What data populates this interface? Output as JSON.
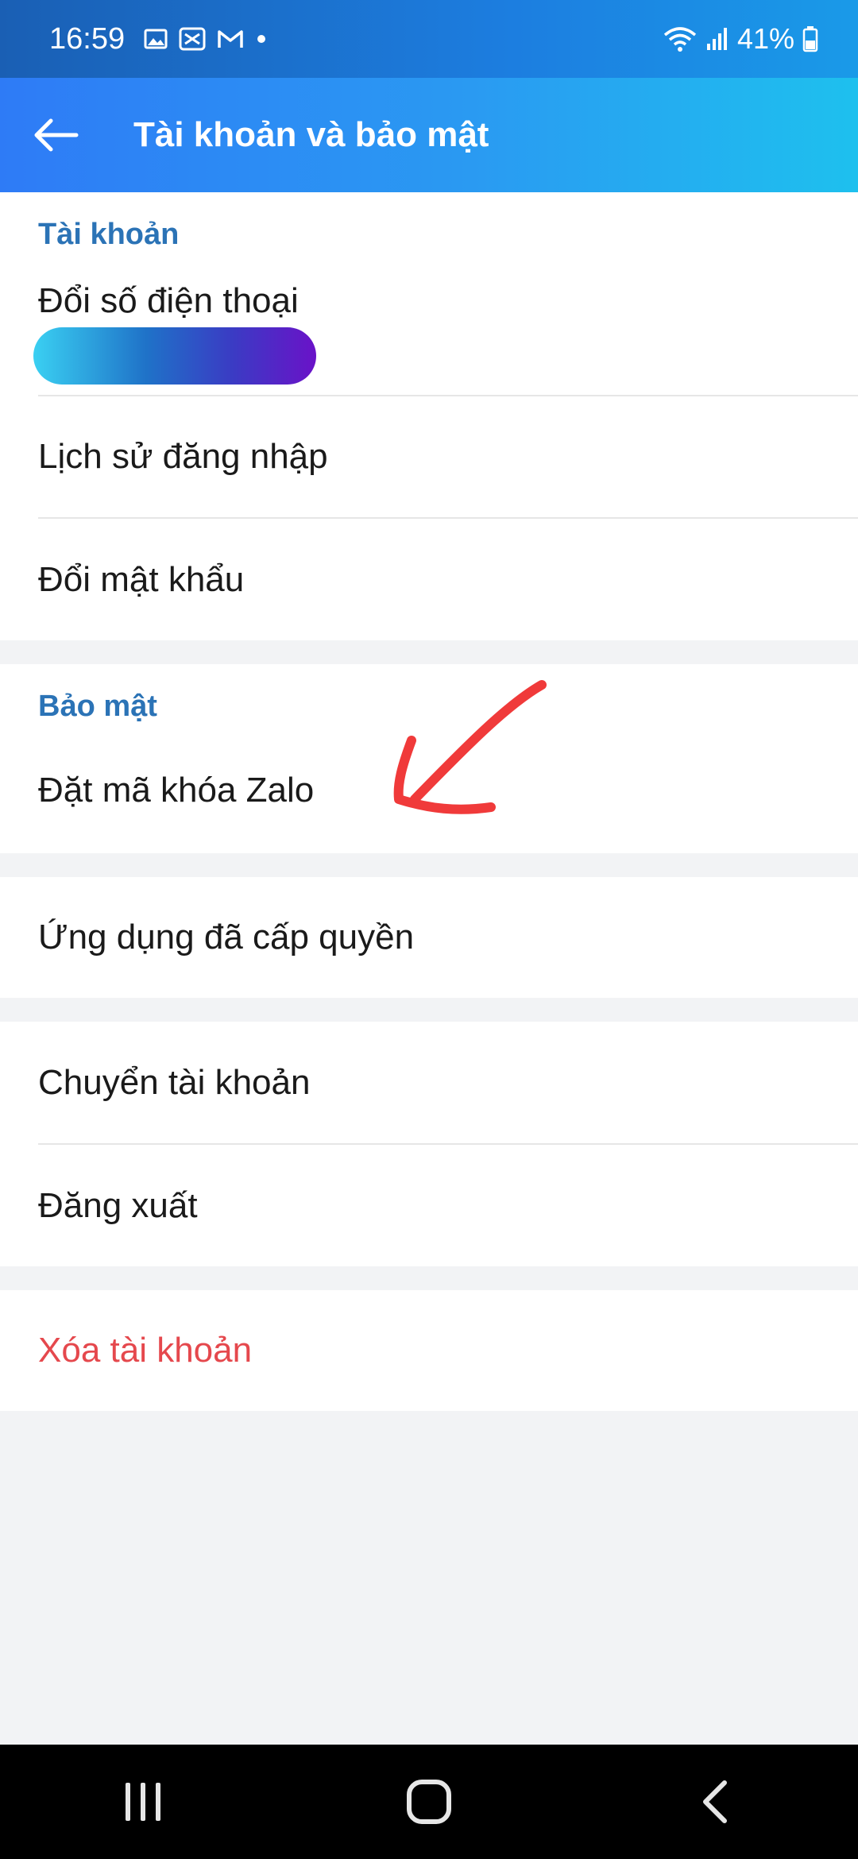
{
  "status_bar": {
    "time": "16:59",
    "battery": "41%",
    "left_icons": [
      "gallery-icon",
      "capcut-icon",
      "gmail-icon",
      "dot-icon"
    ],
    "right_icons": [
      "wifi-icon",
      "signal-icon",
      "battery-icon"
    ]
  },
  "header": {
    "title": "Tài khoản và bảo mật",
    "back_icon": "back-arrow-icon",
    "gradient_start": "#2e7bf6",
    "gradient_end": "#1ec0ee"
  },
  "sections": {
    "account": {
      "header": "Tài khoản",
      "items": [
        {
          "label": "Đổi số điện thoại"
        },
        {
          "label": "Lịch sử đăng nhập"
        },
        {
          "label": "Đổi mật khẩu"
        }
      ]
    },
    "security": {
      "header": "Bảo mật",
      "items": [
        {
          "label": "Đặt mã khóa Zalo"
        }
      ]
    },
    "apps": {
      "items": [
        {
          "label": "Ứng dụng đã cấp quyền"
        }
      ]
    },
    "session": {
      "items": [
        {
          "label": "Chuyển tài khoản"
        },
        {
          "label": "Đăng xuất"
        }
      ]
    },
    "danger": {
      "items": [
        {
          "label": "Xóa tài khoản"
        }
      ]
    }
  },
  "colors": {
    "accent": "#2b73b6",
    "danger": "#e5484d",
    "annotation": "#f03a3a"
  },
  "nav_bar": {
    "buttons": [
      "recents-icon",
      "home-icon",
      "back-icon"
    ]
  }
}
